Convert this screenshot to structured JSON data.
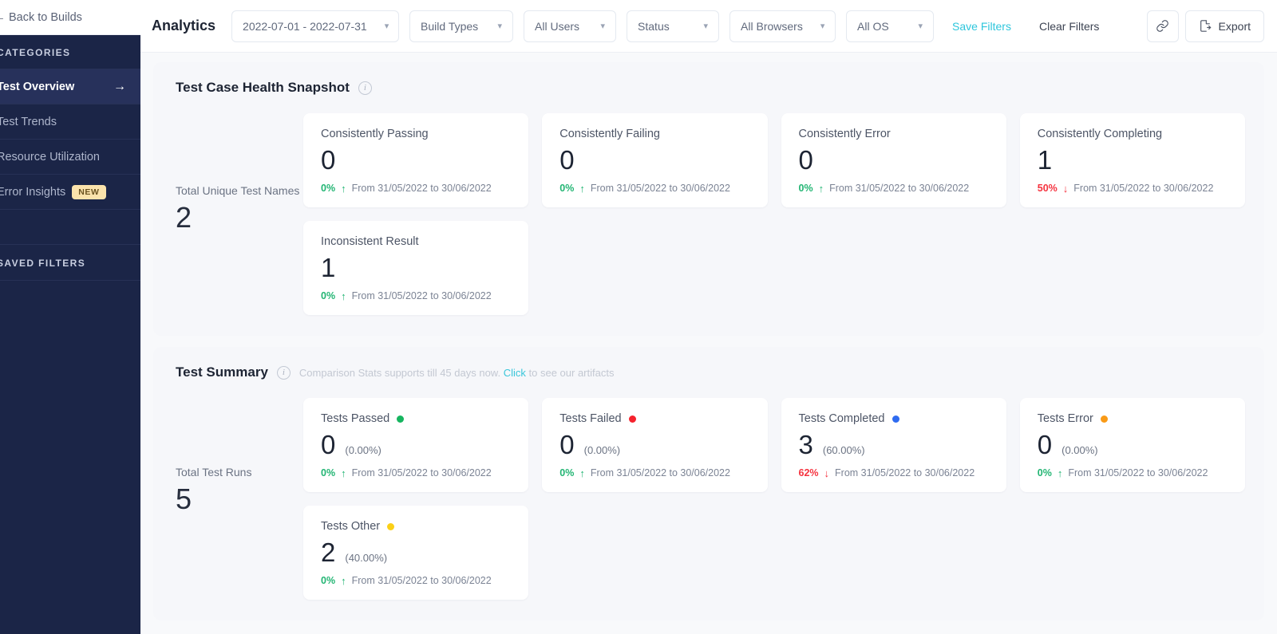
{
  "sidebar": {
    "back_label": "Back to Builds",
    "back_icon": "arrow-left-icon",
    "categories_label": "CATEGORIES",
    "saved_filters_label": "SAVED FILTERS",
    "items": [
      {
        "label": "Test Overview",
        "active": true,
        "badge": null,
        "arrow": "→"
      },
      {
        "label": "Test Trends",
        "active": false,
        "badge": null,
        "arrow": null
      },
      {
        "label": "Resource Utilization",
        "active": false,
        "badge": null,
        "arrow": null
      },
      {
        "label": "Error Insights",
        "active": false,
        "badge": "NEW",
        "arrow": null
      }
    ]
  },
  "topbar": {
    "title": "Analytics",
    "filters": [
      {
        "name": "date-range",
        "value": "2022-07-01 - 2022-07-31"
      },
      {
        "name": "build-types",
        "value": "Build Types"
      },
      {
        "name": "all-users",
        "value": "All Users"
      },
      {
        "name": "status",
        "value": "Status"
      },
      {
        "name": "all-browsers",
        "value": "All Browsers"
      },
      {
        "name": "all-os",
        "value": "All OS"
      }
    ],
    "save_filters_label": "Save Filters",
    "clear_filters_label": "Clear Filters",
    "export_label": "Export",
    "link_icon": "link-icon",
    "export_icon": "file-export-icon",
    "chevron_icon": "chevron-down-icon",
    "accent_color": "#2ec6dc"
  },
  "health": {
    "title": "Test Case Health Snapshot",
    "info_icon": "info-icon",
    "total_label": "Total Unique Test Names",
    "total_value": "2",
    "cards": [
      {
        "title": "Consistently Passing",
        "value": "0",
        "delta": "0%",
        "direction": "up",
        "range": "From 31/05/2022 to 30/06/2022"
      },
      {
        "title": "Consistently Failing",
        "value": "0",
        "delta": "0%",
        "direction": "up",
        "range": "From 31/05/2022 to 30/06/2022"
      },
      {
        "title": "Consistently Error",
        "value": "0",
        "delta": "0%",
        "direction": "up",
        "range": "From 31/05/2022 to 30/06/2022"
      },
      {
        "title": "Consistently Completing",
        "value": "1",
        "delta": "50%",
        "direction": "down",
        "range": "From 31/05/2022 to 30/06/2022"
      },
      {
        "title": "Inconsistent Result",
        "value": "1",
        "delta": "0%",
        "direction": "up",
        "range": "From 31/05/2022 to 30/06/2022"
      }
    ]
  },
  "summary": {
    "title": "Test Summary",
    "info_icon": "info-icon",
    "note_before": "Comparison Stats supports till 45 days now.",
    "note_link": "Click",
    "note_after": "to see our artifacts",
    "total_label": "Total Test Runs",
    "total_value": "5",
    "cards": [
      {
        "title": "Tests Passed",
        "dot": "#16b55f",
        "value": "0",
        "pct": "(0.00%)",
        "delta": "0%",
        "direction": "up",
        "range": "From 31/05/2022 to 30/06/2022"
      },
      {
        "title": "Tests Failed",
        "dot": "#f5222d",
        "value": "0",
        "pct": "(0.00%)",
        "delta": "0%",
        "direction": "up",
        "range": "From 31/05/2022 to 30/06/2022"
      },
      {
        "title": "Tests Completed",
        "dot": "#2f6bf0",
        "value": "3",
        "pct": "(60.00%)",
        "delta": "62%",
        "direction": "down",
        "range": "From 31/05/2022 to 30/06/2022"
      },
      {
        "title": "Tests Error",
        "dot": "#f99a17",
        "value": "0",
        "pct": "(0.00%)",
        "delta": "0%",
        "direction": "up",
        "range": "From 31/05/2022 to 30/06/2022"
      },
      {
        "title": "Tests Other",
        "dot": "#fbd017",
        "value": "2",
        "pct": "(40.00%)",
        "delta": "0%",
        "direction": "up",
        "range": "From 31/05/2022 to 30/06/2022"
      }
    ]
  },
  "arrows": {
    "up": "↑",
    "down": "↓"
  }
}
